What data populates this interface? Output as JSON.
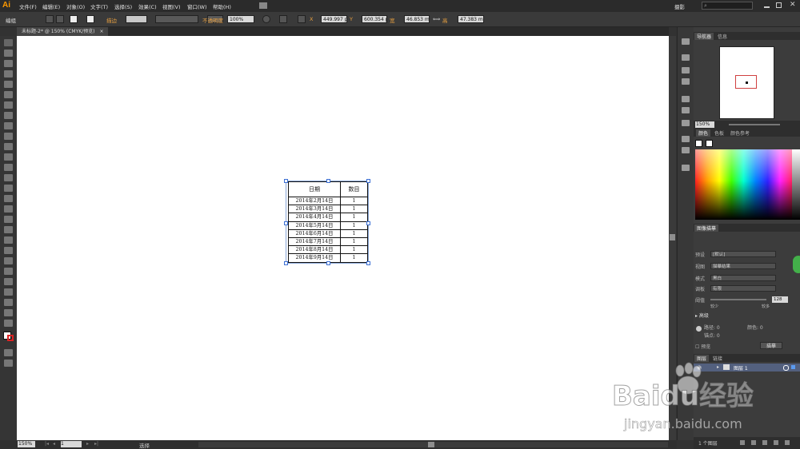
{
  "app": {
    "logo": "Ai",
    "workspace": "摄影",
    "search_placeholder": ""
  },
  "menu": [
    "文件(F)",
    "编辑(E)",
    "对象(O)",
    "文字(T)",
    "选择(S)",
    "效果(C)",
    "视图(V)",
    "窗口(W)",
    "帮助(H)"
  ],
  "control_bar": {
    "mode_label": "编组",
    "stroke_label": "描边",
    "opacity_label": "不透明度",
    "opacity_value": "100%",
    "x_label": "X",
    "x_value": "449.997 p",
    "y_label": "Y",
    "y_value": "600.354 p",
    "w_label": "宽",
    "w_value": "46.853 m",
    "h_label": "高",
    "h_value": "47.383 m"
  },
  "document_tab": {
    "label": "未标题-2* @ 150% (CMYK/预览)",
    "close": "×"
  },
  "artwork_table": {
    "headers": [
      "日期",
      "数目"
    ],
    "rows": [
      [
        "2014年2月14日",
        "1"
      ],
      [
        "2014年3月14日",
        "1"
      ],
      [
        "2014年4月14日",
        "1"
      ],
      [
        "2014年5月14日",
        "1"
      ],
      [
        "2014年6月14日",
        "1"
      ],
      [
        "2014年7月14日",
        "1"
      ],
      [
        "2014年8月14日",
        "1"
      ],
      [
        "2014年9月14日",
        "1"
      ]
    ]
  },
  "navigator_panel": {
    "tab_active": "导航器",
    "tab_other": "信息",
    "zoom": "150%"
  },
  "color_panel": {
    "tab_active": "颜色",
    "tab_2": "色板",
    "tab_3": "颜色参考"
  },
  "image_trace_panel": {
    "title": "图像描摹",
    "preset_label": "预设",
    "preset_value": "[默认]",
    "view_label": "视图",
    "view_value": "描摹结果",
    "mode_label": "模式",
    "mode_value": "黑白",
    "palette_label": "调板",
    "palette_value": "有限",
    "threshold_label": "阈值",
    "threshold_value": "128",
    "threshold_min": "较少",
    "threshold_max": "较多",
    "advanced_label": "高级",
    "paths_label": "路径: 0",
    "colors_label": "颜色: 0",
    "anchors_label": "锚点: 0",
    "preview_label": "预览",
    "trace_button": "描摹"
  },
  "layers_panel": {
    "tab_active": "图层",
    "tab_other": "链接",
    "layer_name": "图层 1",
    "footer": "1 个图层"
  },
  "status_bar": {
    "zoom": "150%",
    "page": "1",
    "tool": "选择"
  },
  "watermark": {
    "brand": "Baidu经验",
    "url": "jingyan.baidu.com"
  }
}
